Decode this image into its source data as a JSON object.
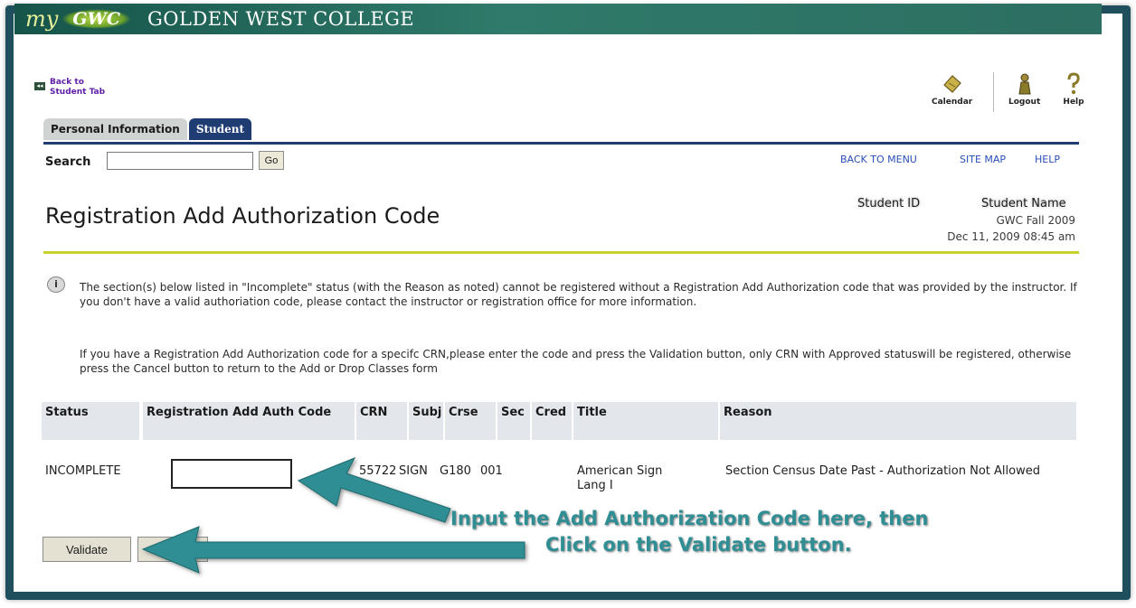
{
  "header": {
    "logo_my": "my",
    "logo_gwc": "GWC",
    "college_name": "GOLDEN WEST COLLEGE"
  },
  "back_link": {
    "line1": "Back to",
    "line2": "Student Tab"
  },
  "utility": {
    "calendar": {
      "label": "Calendar",
      "icon": "calendar-icon"
    },
    "logout": {
      "label": "Logout",
      "icon": "logout-icon"
    },
    "help": {
      "label": "Help",
      "icon": "help-icon"
    }
  },
  "tabs": [
    {
      "label": "Personal Information"
    },
    {
      "label": "Student"
    }
  ],
  "search": {
    "label": "Search",
    "value": "",
    "button": "Go"
  },
  "top_links": {
    "back_to_menu": "BACK TO MENU",
    "site_map": "SITE MAP",
    "help": "HELP"
  },
  "page": {
    "title": "Registration Add Authorization Code",
    "student_id_label": "Student ID",
    "student_name_label": "Student Name",
    "term": "GWC Fall 2009",
    "datetime": "Dec 11, 2009 08:45 am"
  },
  "info": {
    "para1": "The section(s) below listed in \"Incomplete\" status (with the Reason as noted) cannot be registered without a Registration Add Authorization code that was provided by the instructor. If you don't have a valid authoriation code, please contact the instructor or registration office for more information.",
    "para2": "If you have a Registration Add Authorization code for a specifc CRN,please enter the code and press the Validation button, only CRN with Approved statuswill be registered, otherwise press the Cancel button to return to the Add or Drop Classes form"
  },
  "table": {
    "headers": {
      "status": "Status",
      "auth_code": "Registration Add Auth Code",
      "crn": "CRN",
      "subj": "Subj",
      "crse": "Crse",
      "sec": "Sec",
      "cred": "Cred",
      "title": "Title",
      "reason": "Reason"
    },
    "rows": [
      {
        "status": "INCOMPLETE",
        "auth_code": "",
        "crn": "55722",
        "subj": "SIGN",
        "crse": "G180",
        "sec": "001",
        "cred": "",
        "title": "American Sign Lang I",
        "reason": "Section Census Date Past - Authorization Not Allowed"
      }
    ]
  },
  "buttons": {
    "validate": "Validate",
    "cancel": "Cancel"
  },
  "callout": {
    "line1": "Input the Add Authorization Code here, then",
    "line2": "Click on the Validate button."
  },
  "colors": {
    "frame": "#1f4e5c",
    "banner": "#2f7a6a",
    "tab_active": "#1f3c73",
    "title_rule": "#c9d22a",
    "link": "#2a4fb7",
    "callout_arrow": "#2f8e93"
  }
}
